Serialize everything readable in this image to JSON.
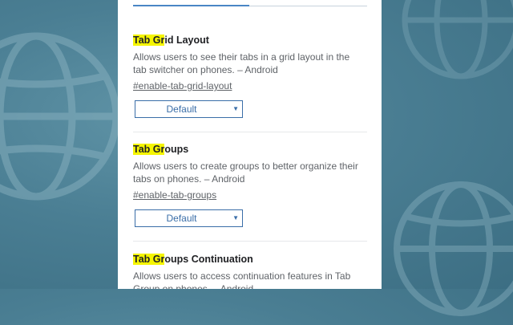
{
  "experiments": [
    {
      "title_highlight": "Tab Gr",
      "title_rest": "id Layout",
      "description_line1": "Allows users to see their tabs in a grid layout in the",
      "description_line2": "tab switcher on phones. – Android",
      "link": "#enable-tab-grid-layout",
      "select_value": "Default"
    },
    {
      "title_highlight": "Tab Gr",
      "title_rest": "oups",
      "description_line1": "Allows users to create groups to better organize their",
      "description_line2": "tabs on phones. – Android",
      "link": "#enable-tab-groups",
      "select_value": "Default"
    },
    {
      "title_highlight": "Tab Gr",
      "title_rest": "oups Continuation",
      "description_line1": "Allows users to access continuation features in Tab",
      "description_line2": "Group on phones. – Android"
    }
  ],
  "icons": {
    "dropdown": "triangle-down-icon",
    "background": "globe-icon"
  },
  "colors": {
    "highlight": "#f5f500",
    "accent": "#3a6ea8",
    "background": "#4a7e93"
  }
}
